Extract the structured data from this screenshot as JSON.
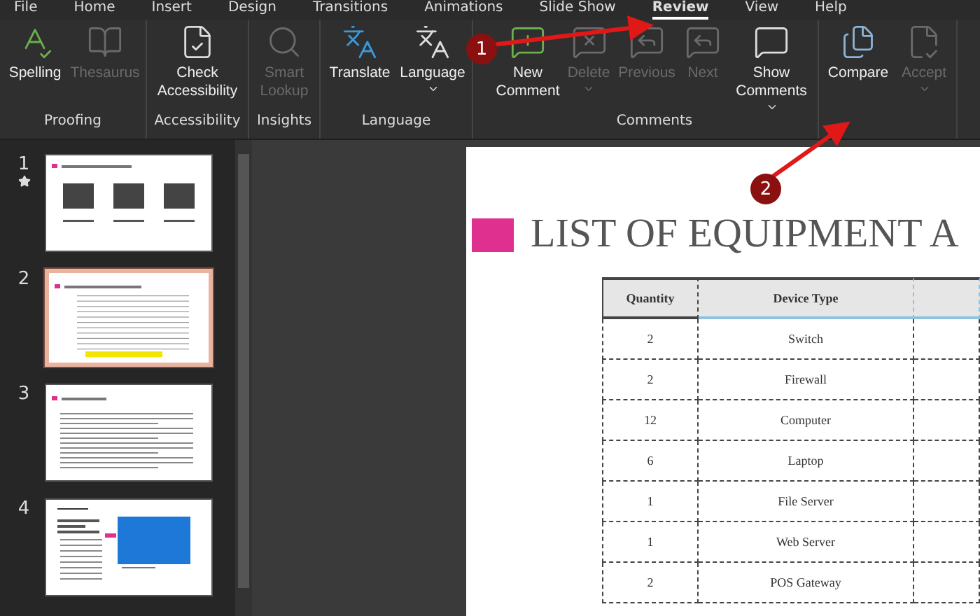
{
  "menu_tabs": [
    {
      "label": "File",
      "selected": false
    },
    {
      "label": "Home",
      "selected": false
    },
    {
      "label": "Insert",
      "selected": false
    },
    {
      "label": "Design",
      "selected": false
    },
    {
      "label": "Transitions",
      "selected": false
    },
    {
      "label": "Animations",
      "selected": false
    },
    {
      "label": "Slide Show",
      "selected": false
    },
    {
      "label": "Review",
      "selected": true
    },
    {
      "label": "View",
      "selected": false
    },
    {
      "label": "Help",
      "selected": false
    }
  ],
  "ribbon_groups": [
    {
      "label": "Proofing",
      "buttons": [
        {
          "kind": "spelling",
          "label": "Spelling",
          "disabled": false,
          "dropdown": false
        },
        {
          "kind": "thesaurus",
          "label": "Thesaurus",
          "disabled": true,
          "dropdown": false
        }
      ]
    },
    {
      "label": "Accessibility",
      "buttons": [
        {
          "kind": "accessibility",
          "label": "Check Accessibility",
          "disabled": false,
          "dropdown": false
        }
      ]
    },
    {
      "label": "Insights",
      "buttons": [
        {
          "kind": "lookup",
          "label": "Smart Lookup",
          "disabled": true,
          "dropdown": false
        }
      ]
    },
    {
      "label": "Language",
      "buttons": [
        {
          "kind": "translate",
          "label": "Translate",
          "disabled": false,
          "dropdown": false
        },
        {
          "kind": "language",
          "label": "Language",
          "disabled": false,
          "dropdown": true
        }
      ]
    },
    {
      "label": "Comments",
      "buttons": [
        {
          "kind": "new-comment",
          "label": "New Comment",
          "disabled": false,
          "dropdown": false
        },
        {
          "kind": "delete",
          "label": "Delete",
          "disabled": true,
          "dropdown": true
        },
        {
          "kind": "previous",
          "label": "Previous",
          "disabled": true,
          "dropdown": false
        },
        {
          "kind": "next",
          "label": "Next",
          "disabled": true,
          "dropdown": false
        },
        {
          "kind": "show-comments",
          "label": "Show Comments",
          "disabled": false,
          "dropdown": true
        }
      ]
    },
    {
      "buttons": [
        {
          "kind": "compare",
          "label": "Compare",
          "disabled": false,
          "dropdown": false
        },
        {
          "kind": "accept",
          "label": "Accept",
          "disabled": true,
          "dropdown": true
        }
      ]
    }
  ],
  "slides": [
    {
      "number": "1",
      "starred": true,
      "selected": false,
      "kind": "boxes"
    },
    {
      "number": "2",
      "starred": false,
      "selected": true,
      "kind": "table"
    },
    {
      "number": "3",
      "starred": false,
      "selected": false,
      "kind": "text"
    },
    {
      "number": "4",
      "starred": false,
      "selected": false,
      "kind": "image"
    }
  ],
  "slide": {
    "title": "LIST OF EQUIPMENT A",
    "table": {
      "columns": [
        "Quantity",
        "Device Type",
        ""
      ],
      "rows": [
        [
          "2",
          "Switch",
          ""
        ],
        [
          "2",
          "Firewall",
          ""
        ],
        [
          "12",
          "Computer",
          ""
        ],
        [
          "6",
          "Laptop",
          ""
        ],
        [
          "1",
          "File Server",
          ""
        ],
        [
          "1",
          "Web Server",
          ""
        ],
        [
          "2",
          "POS Gateway",
          ""
        ]
      ]
    }
  },
  "annotations": [
    {
      "number": "1"
    },
    {
      "number": "2"
    }
  ]
}
